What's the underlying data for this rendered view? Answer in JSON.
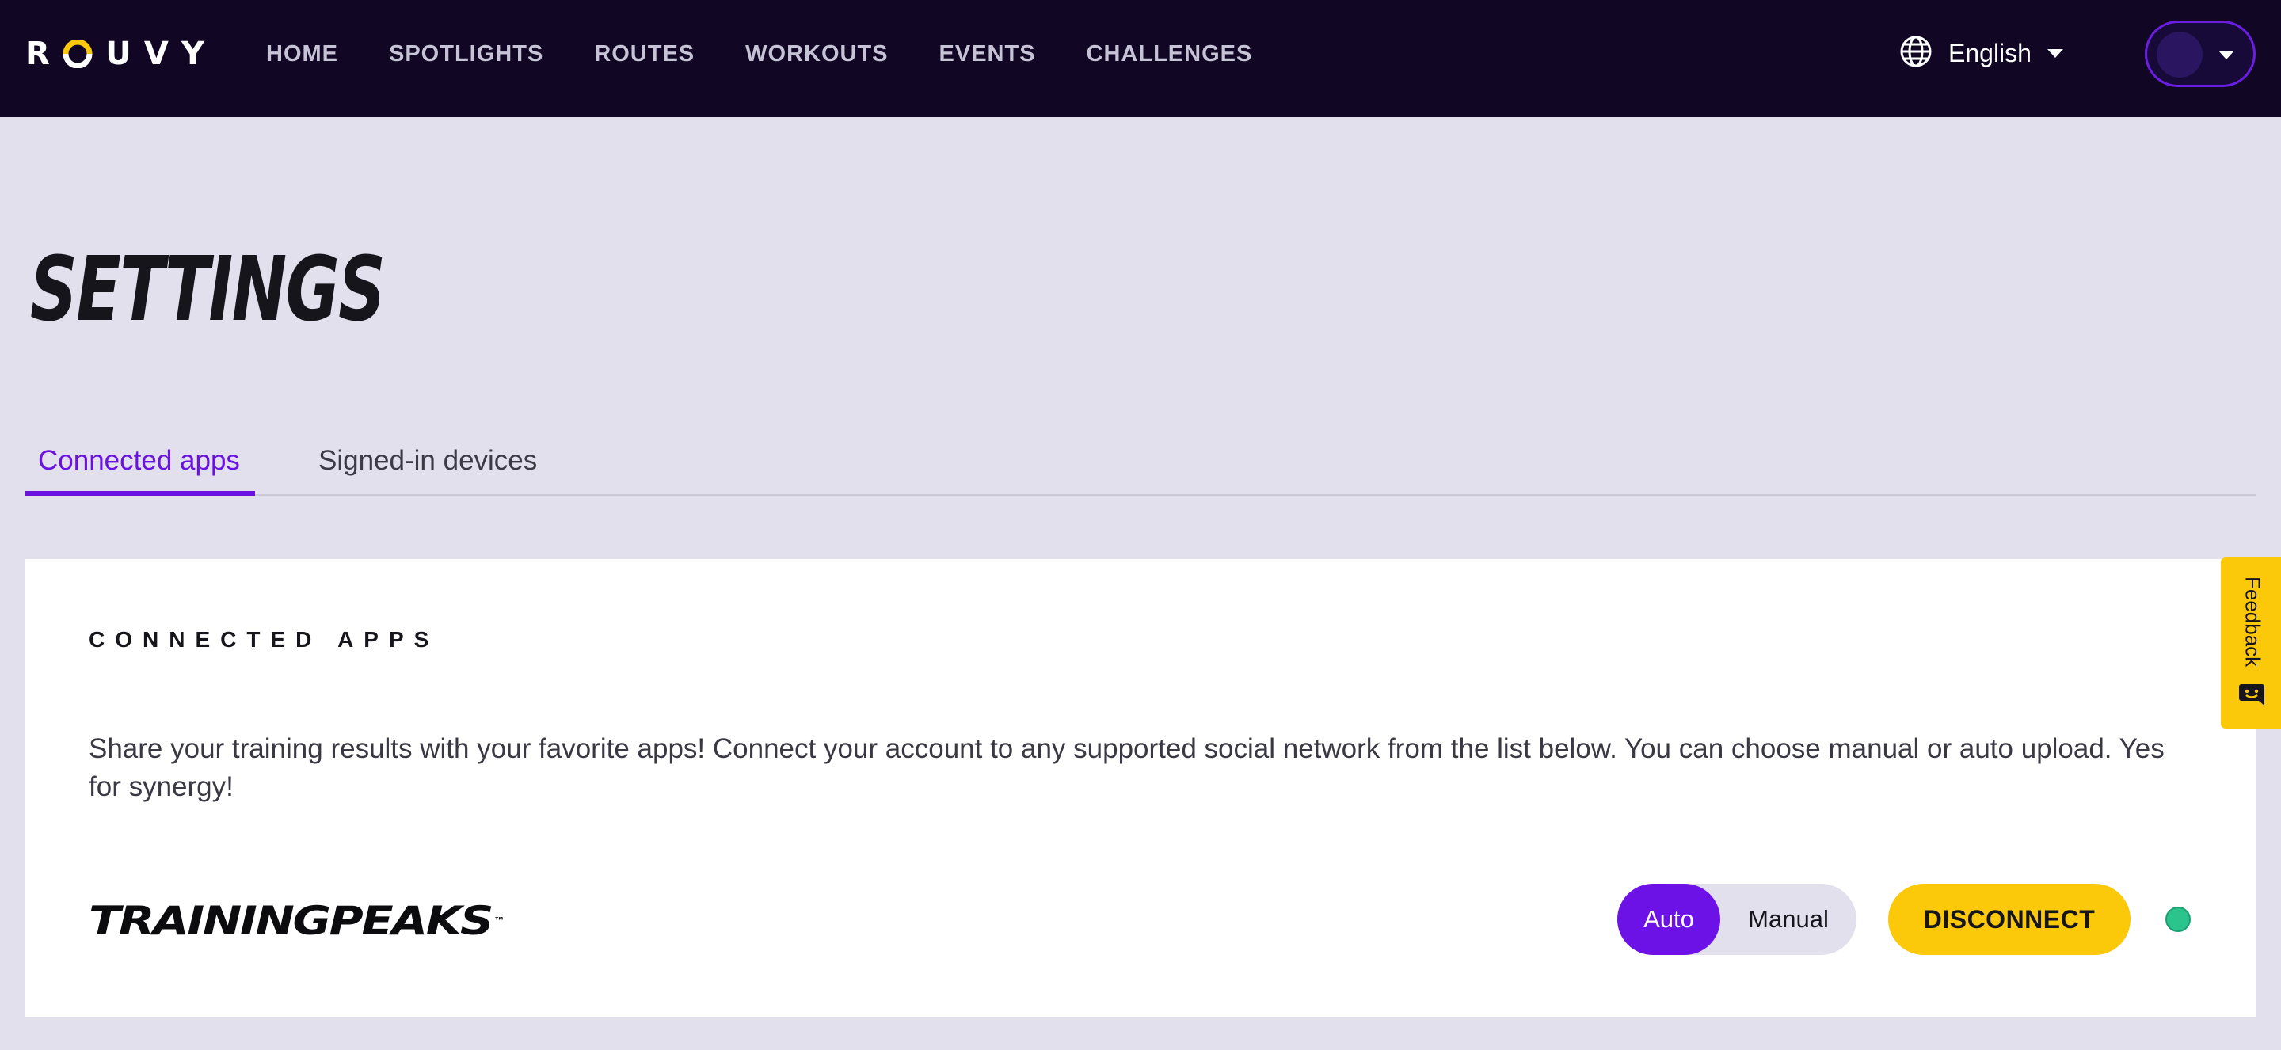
{
  "topbar": {
    "logo": [
      "R",
      "O",
      "U",
      "V",
      "Y"
    ],
    "nav": [
      {
        "label": "HOME"
      },
      {
        "label": "SPOTLIGHTS"
      },
      {
        "label": "ROUTES"
      },
      {
        "label": "WORKOUTS"
      },
      {
        "label": "EVENTS"
      },
      {
        "label": "CHALLENGES"
      }
    ],
    "language": "English",
    "language_icon": "globe-icon",
    "account_icon": "avatar"
  },
  "page": {
    "title": "SETTINGS"
  },
  "tabs": [
    {
      "label": "Connected apps",
      "active": true
    },
    {
      "label": "Signed-in devices",
      "active": false
    }
  ],
  "card": {
    "heading": "CONNECTED APPS",
    "description": "Share your training results with your favorite apps! Connect your account to any supported social network from the list below. You can choose manual or auto upload. Yes for synergy!",
    "apps": [
      {
        "logo_text": "TRAININGPEAKS",
        "logo_mark": "™",
        "upload_options": [
          "Auto",
          "Manual"
        ],
        "upload_selected": "Auto",
        "action_label": "DISCONNECT",
        "status": "connected"
      }
    ]
  },
  "feedback": {
    "label": "Feedback",
    "icon": "chat-icon"
  },
  "colors": {
    "nav_bg": "#110624",
    "page_bg": "#e2e0ec",
    "accent": "#6a12e0",
    "button_yellow": "#fcc80a",
    "status_green": "#2bc48c"
  }
}
